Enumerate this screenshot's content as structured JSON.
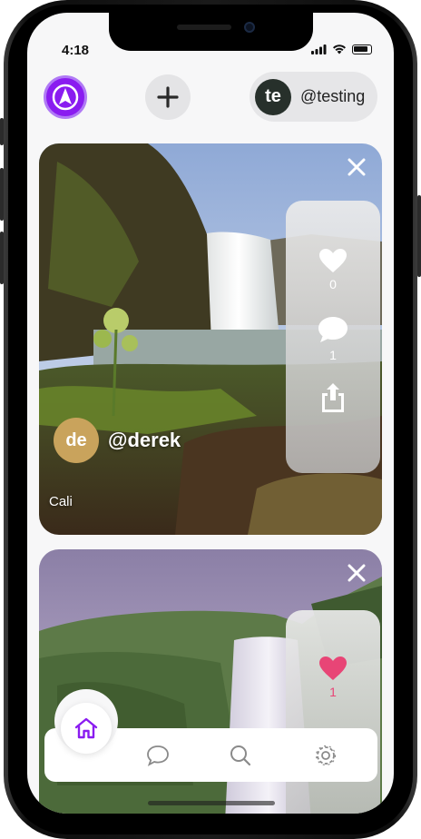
{
  "status_bar": {
    "time": "4:18"
  },
  "header": {
    "profile": {
      "initials": "te",
      "handle": "@testing"
    }
  },
  "posts": [
    {
      "author_initials": "de",
      "author_handle": "@derek",
      "location": "Cali",
      "likes": "0",
      "comments": "1",
      "liked": false
    },
    {
      "likes": "1",
      "liked": true
    }
  ],
  "colors": {
    "brand_purple": "#8a1cf0",
    "like_pink": "#e84576",
    "nav_icon_grey": "#8a8a8a"
  },
  "icons": {
    "logo": "compass-arrow-icon",
    "add": "plus-icon",
    "close": "close-icon",
    "like": "heart-icon",
    "comment": "comment-icon",
    "share": "share-icon",
    "home": "home-icon",
    "messages": "chat-icon",
    "search": "search-icon",
    "settings": "gear-icon"
  }
}
